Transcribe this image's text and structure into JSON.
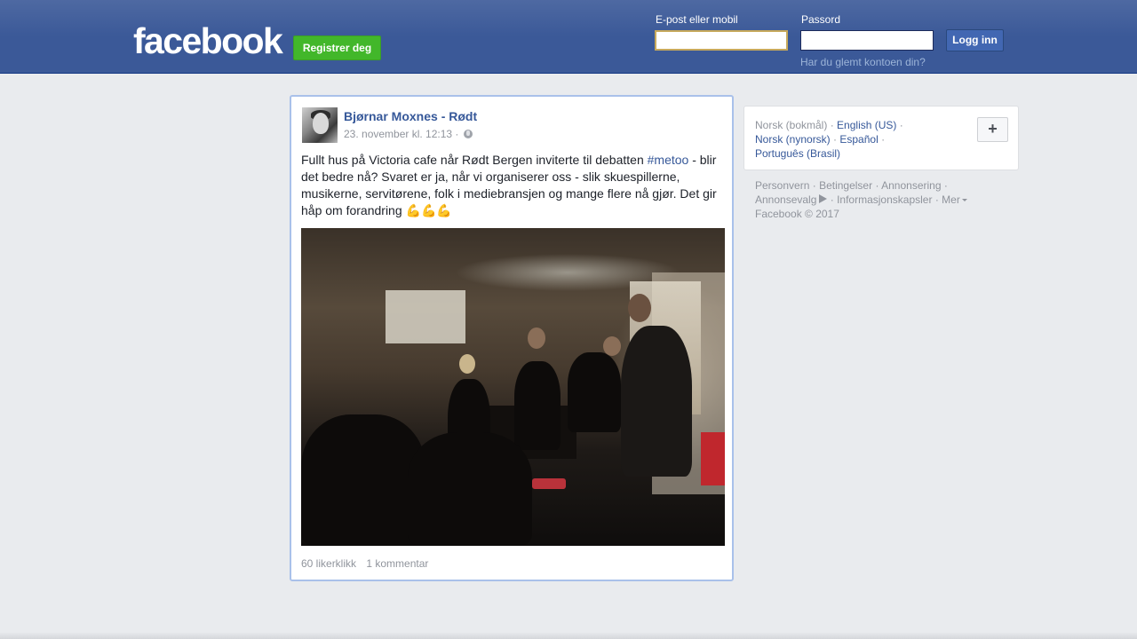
{
  "header": {
    "logo": "facebook",
    "register_label": "Registrer deg",
    "email_label": "E-post eller mobil",
    "email_value": "",
    "password_label": "Passord",
    "password_value": "",
    "login_label": "Logg inn",
    "forgot_label": "Har du glemt kontoen din?",
    "colors": {
      "bar": "#3b5998",
      "register": "#42b72a",
      "login": "#4267b2"
    }
  },
  "post": {
    "author": "Bjørnar Moxnes - Rødt",
    "timestamp": "23. november kl. 12:13",
    "timestamp_separator": "·",
    "privacy_icon": "globe-icon",
    "text_before": "Fullt hus på Victoria cafe når Rødt Bergen inviterte til debatten ",
    "hashtag": "#metoo",
    "text_after": " - blir det bedre nå? Svaret er ja, når vi organiserer oss - slik skuespillerne, musikerne, servitørene, folk i mediebransjen og mange flere nå gjør. Det gir håp om forandring 💪💪💪",
    "likes": "60 likerklikk",
    "comments": "1 kommentar"
  },
  "sidebar": {
    "languages": [
      {
        "label": "Norsk (bokmål)",
        "current": true
      },
      {
        "label": "English (US)",
        "current": false
      },
      {
        "label": "Norsk (nynorsk)",
        "current": false
      },
      {
        "label": "Español",
        "current": false
      },
      {
        "label": "Português (Brasil)",
        "current": false
      }
    ],
    "add_language_label": "+",
    "separator": "·",
    "footer": {
      "privacy": "Personvern",
      "terms": "Betingelser",
      "advertising": "Annonsering",
      "adchoices": "Annonsevalg",
      "cookies": "Informasjonskapsler",
      "more": "Mer",
      "copyright": "Facebook © 2017"
    }
  }
}
